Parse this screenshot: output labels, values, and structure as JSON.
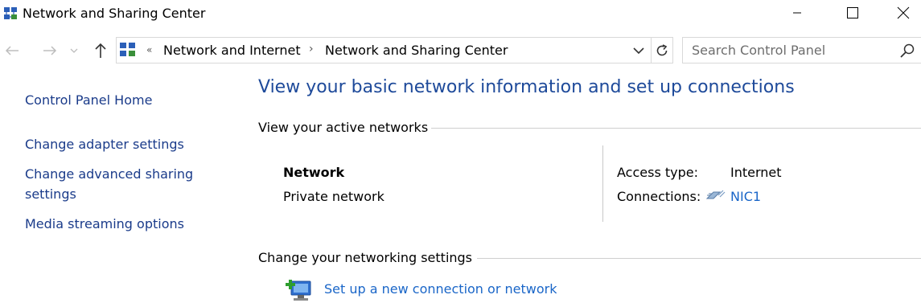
{
  "window": {
    "title": "Network and Sharing Center",
    "controls": {
      "minimize": "minimize",
      "maximize": "maximize",
      "close": "close"
    }
  },
  "nav": {
    "back_icon": "back-arrow-icon",
    "forward_icon": "forward-arrow-icon",
    "recent_icon": "recent-pages-dropdown-icon",
    "up_icon": "up-arrow-icon"
  },
  "address_bar": {
    "overflow": "«",
    "breadcrumbs": [
      "Network and Internet",
      "Network and Sharing Center"
    ],
    "separator": "›"
  },
  "search": {
    "placeholder": "Search Control Panel"
  },
  "sidebar": {
    "items": [
      {
        "label": "Control Panel Home"
      },
      {
        "label": "Change adapter settings"
      },
      {
        "label_line1": "Change advanced sharing",
        "label_line2": "settings"
      },
      {
        "label": "Media streaming options"
      }
    ]
  },
  "main": {
    "heading": "View your basic network information and set up connections",
    "active_networks": {
      "section_title": "View your active networks",
      "network_name": "Network",
      "network_type": "Private network",
      "access_type_label": "Access type:",
      "access_type_value": "Internet",
      "connections_label": "Connections:",
      "connections_value": "NIC1"
    },
    "change_settings": {
      "section_title": "Change your networking settings",
      "items": [
        {
          "label": "Set up a new connection or network"
        }
      ]
    }
  },
  "colors": {
    "link": "#1a66c8",
    "sidebar_link": "#1a3b8a",
    "heading": "#1e4a9a"
  }
}
